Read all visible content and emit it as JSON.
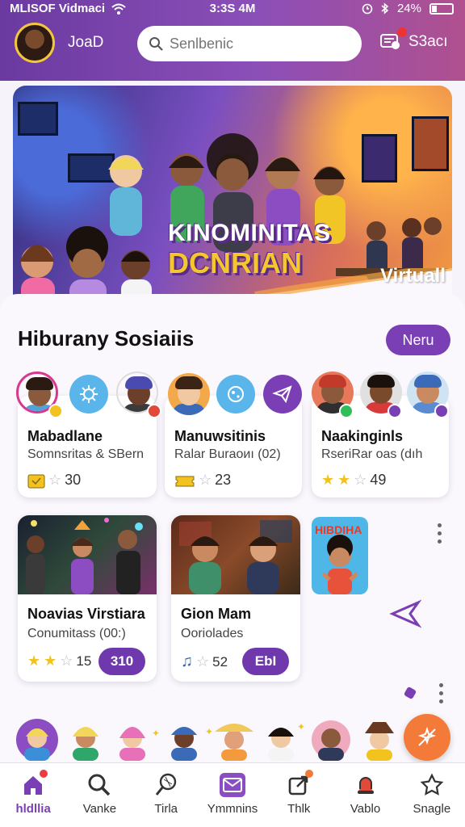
{
  "status_bar": {
    "carrier": "MLISOF Vidmaci",
    "time": "3:3S 4M",
    "battery": "24%"
  },
  "header": {
    "user_label": "JoaD",
    "search_placeholder": "Senlbenic",
    "right_label": "S3acı"
  },
  "hero": {
    "title_line1": "KINOMINITAS",
    "title_line2": "DCNRIAN",
    "badge": "Virtuall"
  },
  "section": {
    "title": "Hiburany Sosiaiis",
    "new_button": "Neru"
  },
  "group_cards": [
    {
      "name": "Mabadlane",
      "sub": "Somnsritas & SBern",
      "stars_on": 0,
      "stars_off": 1,
      "count": "30"
    },
    {
      "name": "Manuwsitinis",
      "sub": "Ralar Buraoиı (02)",
      "stars_on": 0,
      "stars_off": 1,
      "count": "23"
    },
    {
      "name": "Naakinginls",
      "sub": "RseriRar oas (dıh",
      "stars_on": 2,
      "stars_off": 1,
      "count": "49"
    }
  ],
  "media_cards": [
    {
      "name": "Noavias Virstiara",
      "sub": "Conumitass (00:)",
      "stars_on": 2,
      "stars_off": 1,
      "count": "15",
      "action": "310"
    },
    {
      "name": "Gion Mam",
      "sub": "Ooriolades",
      "stars_on": 0,
      "stars_off": 1,
      "count": "52",
      "action": "EbI"
    }
  ],
  "side_thumb_label": "HIBDIHA",
  "nav": [
    {
      "label": "hldllia",
      "icon": "home-icon",
      "active": true
    },
    {
      "label": "Vanke",
      "icon": "search-icon",
      "active": false
    },
    {
      "label": "Tirla",
      "icon": "racket-icon",
      "active": false
    },
    {
      "label": "Ymmnins",
      "icon": "mail-icon",
      "active": false
    },
    {
      "label": "Thlk",
      "icon": "share-icon",
      "active": false
    },
    {
      "label": "Vablo",
      "icon": "bell-icon",
      "active": false
    },
    {
      "label": "Snagle",
      "icon": "star-icon",
      "active": false
    }
  ],
  "colors": {
    "accent": "#7a3fb5",
    "header_start": "#6a3aa0",
    "fab": "#f47a3a",
    "star": "#f2c21e"
  }
}
